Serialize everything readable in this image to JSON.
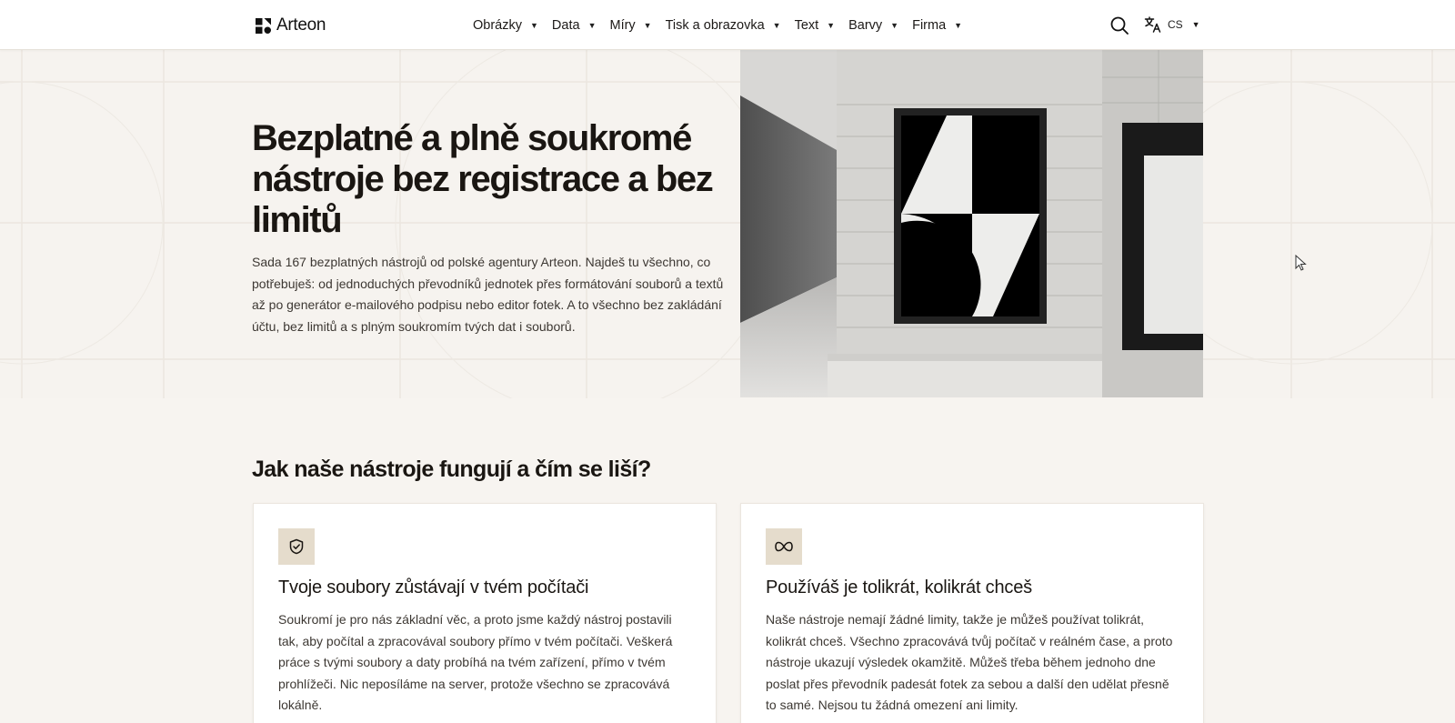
{
  "header": {
    "logo_text": "Arteon",
    "nav": [
      {
        "label": "Obrázky"
      },
      {
        "label": "Data"
      },
      {
        "label": "Míry"
      },
      {
        "label": "Tisk a obrazovka"
      },
      {
        "label": "Text"
      },
      {
        "label": "Barvy"
      },
      {
        "label": "Firma"
      }
    ],
    "lang_label": "CS",
    "icons": {
      "search": "search-icon",
      "translate": "translate-icon",
      "caret": "caret-down-icon"
    }
  },
  "hero": {
    "title": "Bezplatné a plně soukromé nástroje bez registrace a bez limitů",
    "text": "Sada 167 bezplatných nástrojů od polské agentury Arteon. Najdeš tu všechno, co potřebuješ: od jednoduchých převodníků jednotek přes formátování souborů a textů až po generátor e-mailového podpisu nebo editor fotek. A to všechno bez zakládání účtu, bez limitů a s plným soukromím tvých dat i souborů."
  },
  "section": {
    "title": "Jak naše nástroje fungují a čím se liší?",
    "cards": [
      {
        "icon": "shield-check-icon",
        "title": "Tvoje soubory zůstávají v tvém počítači",
        "text": "Soukromí je pro nás základní věc, a proto jsme každý nástroj postavili tak, aby počítal a zpracovával soubory přímo v tvém počítači. Veškerá práce s tvými soubory a daty probíhá na tvém zařízení, přímo v tvém prohlížeči. Nic neposíláme na server, protože všechno se zpracovává lokálně."
      },
      {
        "icon": "infinity-icon",
        "title": "Používáš je tolikrát, kolikrát chceš",
        "text": "Naše nástroje nemají žádné limity, takže je můžeš používat tolikrát, kolikrát chceš. Všechno zpracovává tvůj počítač v reálném čase, a proto nástroje ukazují výsledek okamžitě. Můžeš třeba během jednoho dne poslat přes převodník padesát fotek za sebou a další den udělat přesně to samé. Nejsou tu žádná omezení ani limity."
      }
    ]
  },
  "colors": {
    "background": "#f7f4f0",
    "card_icon_bg": "#e5dccc",
    "text_dark": "#1a1612"
  }
}
